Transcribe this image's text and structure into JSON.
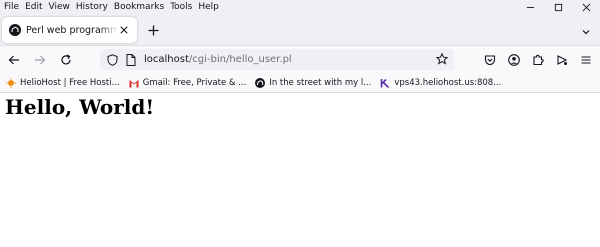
{
  "menu": {
    "items": [
      "File",
      "Edit",
      "View",
      "History",
      "Bookmarks",
      "Tools",
      "Help"
    ]
  },
  "tab": {
    "title": "Perl web programming (Perl script)"
  },
  "urlbar": {
    "host": "localhost",
    "path": "/cgi-bin/hello_user.pl"
  },
  "bookmarks": [
    {
      "label": "HelioHost | Free Hosti...",
      "icon": "heliohost-icon"
    },
    {
      "label": "Gmail: Free, Private & ...",
      "icon": "gmail-icon"
    },
    {
      "label": "In the street with my l...",
      "icon": "perl-camel-icon"
    },
    {
      "label": "vps43.heliohost.us:808...",
      "icon": "vps-icon"
    }
  ],
  "page": {
    "heading": "Hello, World!"
  },
  "colors": {
    "chrome": "#f0f0f4",
    "toolbar": "#f9f9fb",
    "text": "#15141a",
    "gmail_red": "#d93025",
    "helio_orange": "#f29111"
  }
}
